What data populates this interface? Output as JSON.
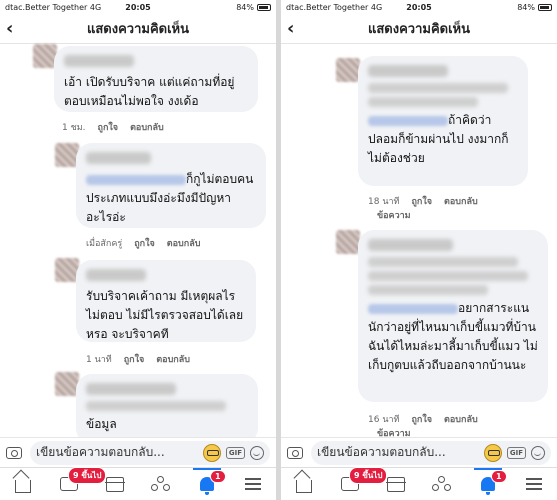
{
  "status": {
    "carrier": "dtac.Better Together",
    "network": "4G",
    "time": "20:05",
    "battery": "84%"
  },
  "header": {
    "back_icon": "chevron-left-icon",
    "title": "แสดงความคิดเห็น"
  },
  "left_comments": [
    {
      "text": "เอ้า เปิดรับบริจาค แต่แค่ถามที่อยู่ ตอบเหมือนไม่พอใจ งงเด้อ",
      "time": "1 ชม.",
      "like": "ถูกใจ",
      "reply": "ตอบกลับ"
    },
    {
      "text": "ก็กูไม่ตอบคนประเภทแบบมึงอ่ะมึงมีปัญหาอะไรอ่ะ",
      "time": "เมื่อสักครู่",
      "like": "ถูกใจ",
      "reply": "ตอบกลับ"
    },
    {
      "text": "รับบริจาคเค้าถาม มีเหตุผลไรไม่ตอบ ไม่มีไรตรวจสอบได้เลยหรอ จะบริจาคที",
      "time": "1 นาที",
      "like": "ถูกใจ",
      "reply": "ตอบกลับ"
    },
    {
      "text": "ข้อมูล"
    }
  ],
  "right_comments": [
    {
      "text": "ถ้าคิดว่าปลอมก็ข้ามผ่านไป งงมากก็ไม่ต้องช่วย",
      "time": "18 นาที",
      "like": "ถูกใจ",
      "reply": "ตอบกลับ",
      "extra": "ข้อความ"
    },
    {
      "text": "อยากสาระแนนักว่าอยู่ที่ไหนมาเก็บขี้แมวที่บ้านฉันได้ไหมล่ะมาลี้มาเก็บขี้แมว ไม่เก็บกูตบแล้วถีบออกจากบ้านนะ",
      "time": "16 นาที",
      "like": "ถูกใจ",
      "reply": "ตอบกลับ",
      "extra": "ข้อความ"
    }
  ],
  "composer": {
    "placeholder": "เขียนข้อความตอบกลับ...",
    "gif_label": "GIF"
  },
  "tabbar": {
    "video_badge": "9 ขึ้นไป",
    "notif_badge": "1",
    "accent": "#1877f2"
  }
}
